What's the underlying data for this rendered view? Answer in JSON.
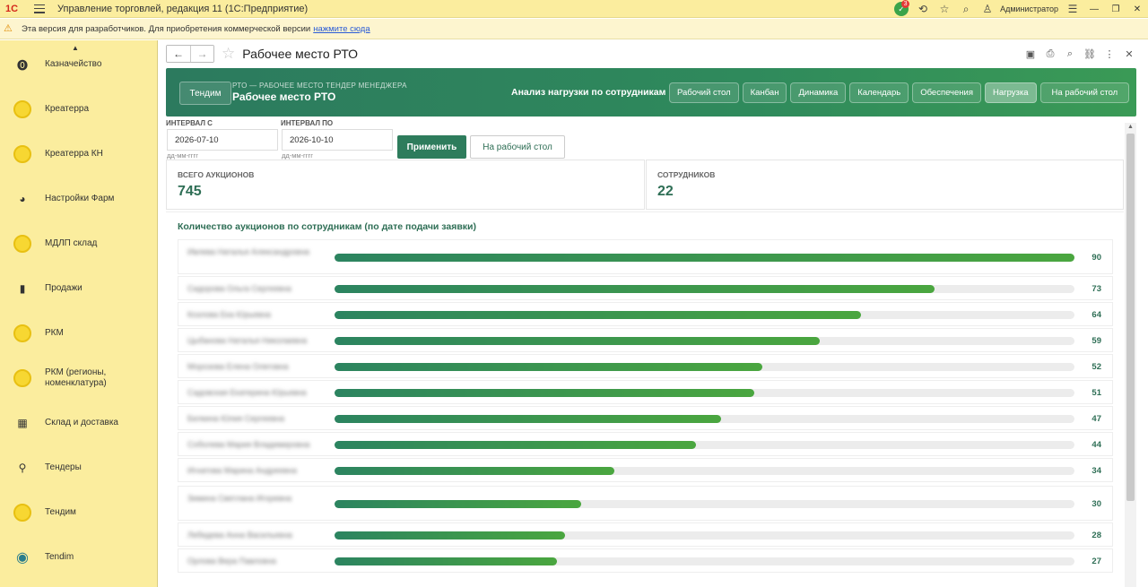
{
  "app": {
    "title": "Управление торговлей, редакция 11  (1С:Предприятие)",
    "logo": "1С",
    "notifications_count": "3",
    "user": "Администратор"
  },
  "dev_banner": {
    "text": "Эта версия для разработчиков. Для приобретения коммерческой версии",
    "link": "нажмите сюда"
  },
  "sidebar": {
    "items": [
      {
        "label": "Казначейство",
        "icon": "treasury-icon"
      },
      {
        "label": "Креатерра",
        "icon": "coin-icon"
      },
      {
        "label": "Креатерра КН",
        "icon": "coin-icon"
      },
      {
        "label": "Настройки Фарм",
        "icon": "rss-icon"
      },
      {
        "label": "МДЛП склад",
        "icon": "coin-icon"
      },
      {
        "label": "Продажи",
        "icon": "bag-icon"
      },
      {
        "label": "РКМ",
        "icon": "coin-icon"
      },
      {
        "label": "РКМ (регионы, номенклатура)",
        "icon": "coin-icon"
      },
      {
        "label": "Склад и доставка",
        "icon": "grid-icon"
      },
      {
        "label": "Тендеры",
        "icon": "tender-icon"
      },
      {
        "label": "Тендим",
        "icon": "coin-icon"
      },
      {
        "label": "Tendim",
        "icon": "lightbulb-icon"
      }
    ]
  },
  "form": {
    "title": "Рабочее место РТО"
  },
  "band": {
    "tendim_button": "Тендим",
    "subtitle": "РТО — РАБОЧЕЕ МЕСТО ТЕНДЕР МЕНЕДЖЕРА",
    "title": "Рабочее место РТО",
    "section_label": "Анализ нагрузки по сотрудникам",
    "tabs": [
      {
        "label": "Рабочий стол",
        "active": false
      },
      {
        "label": "Канбан",
        "active": false
      },
      {
        "label": "Динамика",
        "active": false
      },
      {
        "label": "Календарь",
        "active": false
      },
      {
        "label": "Обеспечения",
        "active": false
      },
      {
        "label": "Нагрузка",
        "active": true
      },
      {
        "label": "На рабочий стол",
        "active": false
      }
    ]
  },
  "filters": {
    "from_label": "ИНТЕРВАЛ С",
    "from_value": "2026-07-10",
    "to_label": "ИНТЕРВАЛ ПО",
    "to_value": "2026-10-10",
    "hint": "дд-мм-гггг",
    "apply": "Применить",
    "to_desktop": "На рабочий стол"
  },
  "kpis": {
    "auctions_label": "ВСЕГО АУКЦИОНОВ",
    "auctions_value": "745",
    "employees_label": "СОТРУДНИКОВ",
    "employees_value": "22"
  },
  "chart_data": {
    "type": "bar",
    "title": "Количество аукционов по сотрудникам (по дате подачи заявки)",
    "orientation": "horizontal",
    "max": 90,
    "categories": [
      "Ивлева Наталья Александровна",
      "Сидорова Ольга Сергеевна",
      "Козлова Ека Юрьевна",
      "Цыбанова Наталья Николаевна",
      "Морозова Елена Олеговна",
      "Садовская Екатерина Юрьевна",
      "Белкина Юлия Сергеевна",
      "Соболева Мария Владимировна",
      "Игнатова Марина Андреевна",
      "Зимина Светлана Игоревна",
      "Лебедева Анна Васильевна",
      "Орлова Вера Павловна"
    ],
    "values": [
      90,
      73,
      64,
      59,
      52,
      51,
      47,
      44,
      34,
      30,
      28,
      27
    ]
  }
}
